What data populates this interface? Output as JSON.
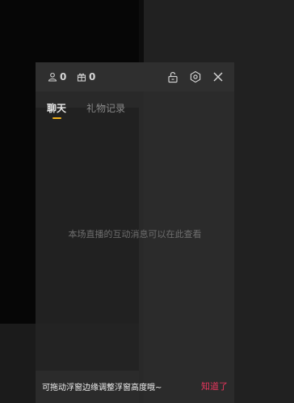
{
  "header": {
    "viewer_count": "0",
    "gift_count": "0",
    "icons": [
      "person-icon",
      "gift-icon",
      "unlock-icon",
      "settings-icon",
      "close-icon"
    ]
  },
  "tabs": [
    {
      "label": "聊天",
      "active": true
    },
    {
      "label": "礼物记录",
      "active": false
    }
  ],
  "chat": {
    "empty_message": "本场直播的互动消息可以在此查看"
  },
  "tooltip": {
    "text": "可拖动浮窗边缘调整浮窗高度哦~",
    "action_label": "知道了"
  },
  "colors": {
    "accent_tab": "#f2b21e",
    "action_link": "#e8365d",
    "panel_bg": "#2c2c2c"
  }
}
